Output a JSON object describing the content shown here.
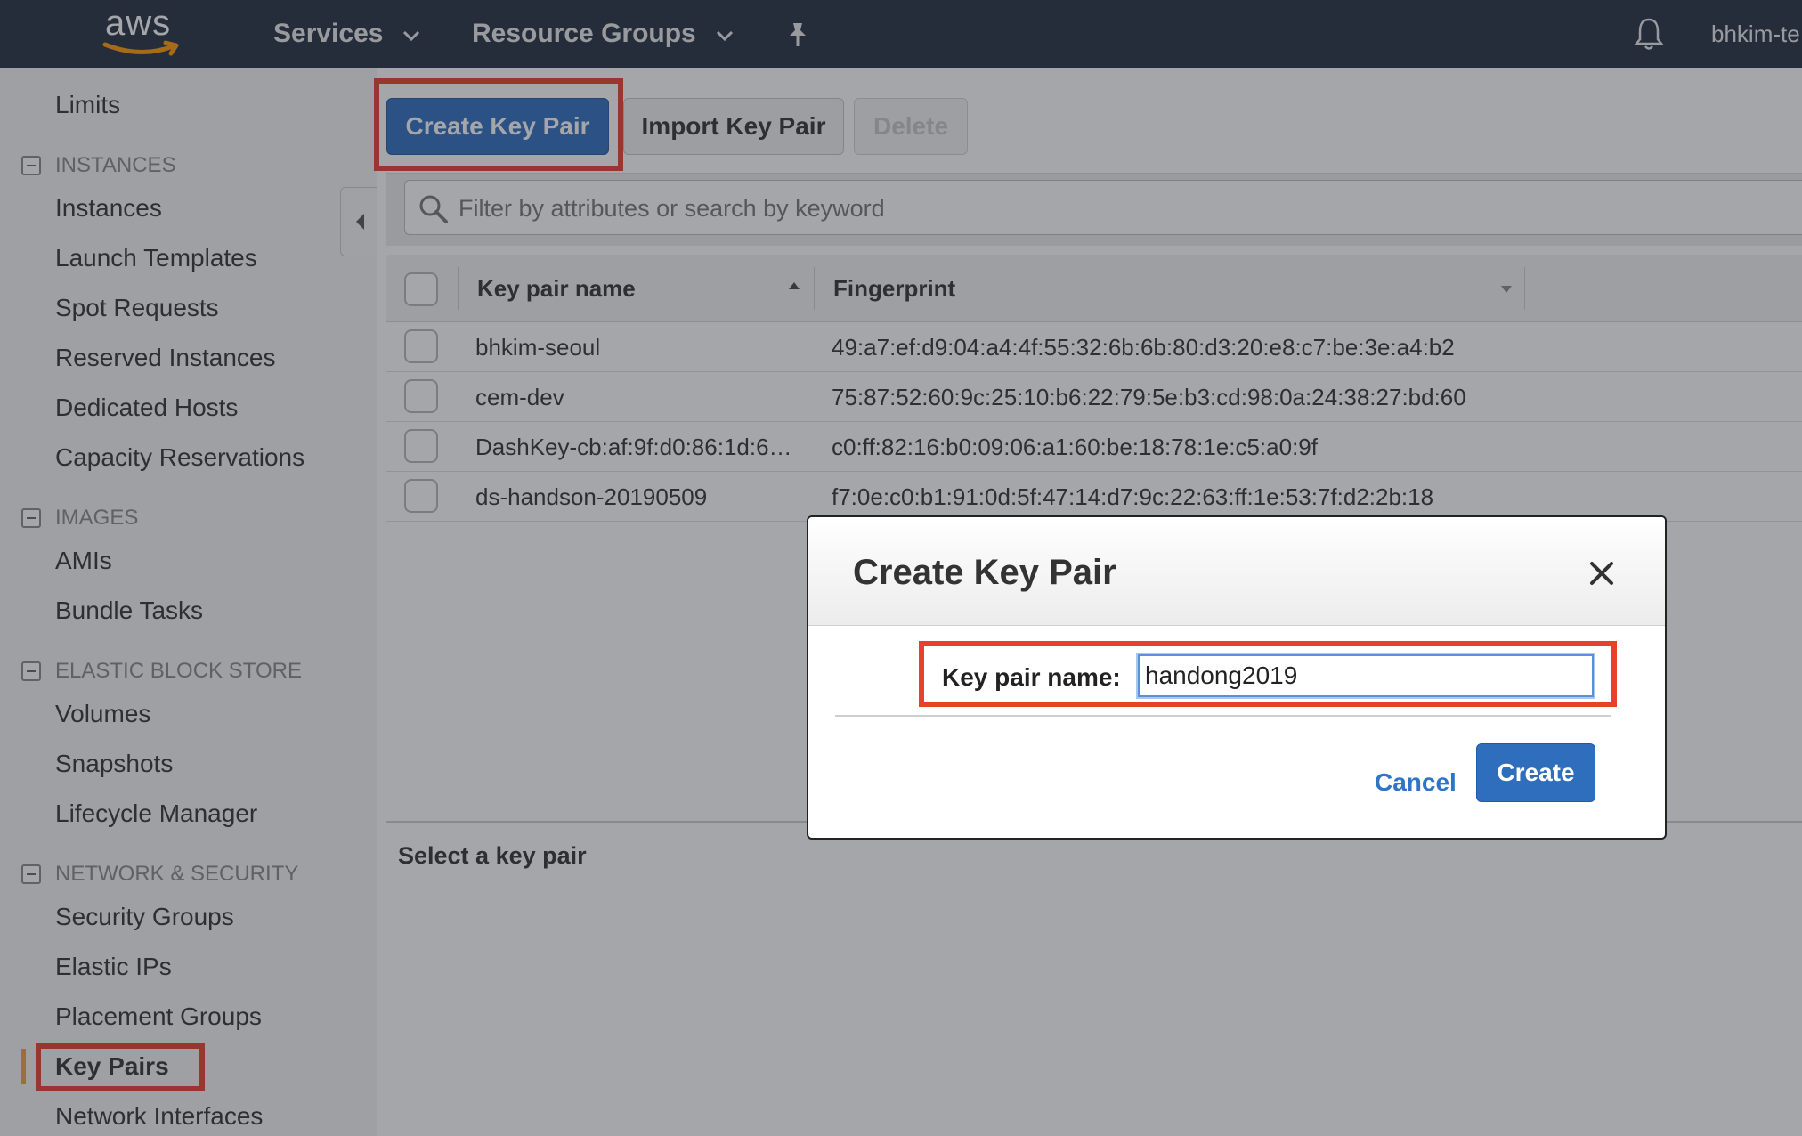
{
  "topnav": {
    "logo_text": "aws",
    "services": "Services",
    "resource_groups": "Resource Groups",
    "user": "bhkim-te"
  },
  "sidebar": {
    "limits": "Limits",
    "sections": [
      {
        "title": "INSTANCES",
        "items": [
          "Instances",
          "Launch Templates",
          "Spot Requests",
          "Reserved Instances",
          "Dedicated Hosts",
          "Capacity Reservations"
        ]
      },
      {
        "title": "IMAGES",
        "items": [
          "AMIs",
          "Bundle Tasks"
        ]
      },
      {
        "title": "ELASTIC BLOCK STORE",
        "items": [
          "Volumes",
          "Snapshots",
          "Lifecycle Manager"
        ]
      },
      {
        "title": "NETWORK & SECURITY",
        "items": [
          "Security Groups",
          "Elastic IPs",
          "Placement Groups",
          "Key Pairs",
          "Network Interfaces"
        ]
      }
    ],
    "active_item": "Key Pairs"
  },
  "toolbar": {
    "create_label": "Create Key Pair",
    "import_label": "Import Key Pair",
    "delete_label": "Delete"
  },
  "search": {
    "placeholder": "Filter by attributes or search by keyword"
  },
  "table": {
    "columns": [
      "Key pair name",
      "Fingerprint"
    ],
    "rows": [
      {
        "name": "bhkim-seoul",
        "fingerprint": "49:a7:ef:d9:04:a4:4f:55:32:6b:6b:80:d3:20:e8:c7:be:3e:a4:b2"
      },
      {
        "name": "cem-dev",
        "fingerprint": "75:87:52:60:9c:25:10:b6:22:79:5e:b3:cd:98:0a:24:38:27:bd:60"
      },
      {
        "name": "DashKey-cb:af:9f:d0:86:1d:6…",
        "fingerprint": "c0:ff:82:16:b0:09:06:a1:60:be:18:78:1e:c5:a0:9f"
      },
      {
        "name": "ds-handson-20190509",
        "fingerprint": "f7:0e:c0:b1:91:0d:5f:47:14:d7:9c:22:63:ff:1e:53:7f:d2:2b:18"
      }
    ]
  },
  "detail": {
    "label": "Select a key pair"
  },
  "modal": {
    "title": "Create Key Pair",
    "field_label": "Key pair name:",
    "field_value": "handong2019",
    "cancel_label": "Cancel",
    "create_label": "Create"
  },
  "colors": {
    "topbar": "#232f3e",
    "primary": "#2f6dbd",
    "annotation": "#e8412a",
    "active_marker": "#e9a23b"
  }
}
